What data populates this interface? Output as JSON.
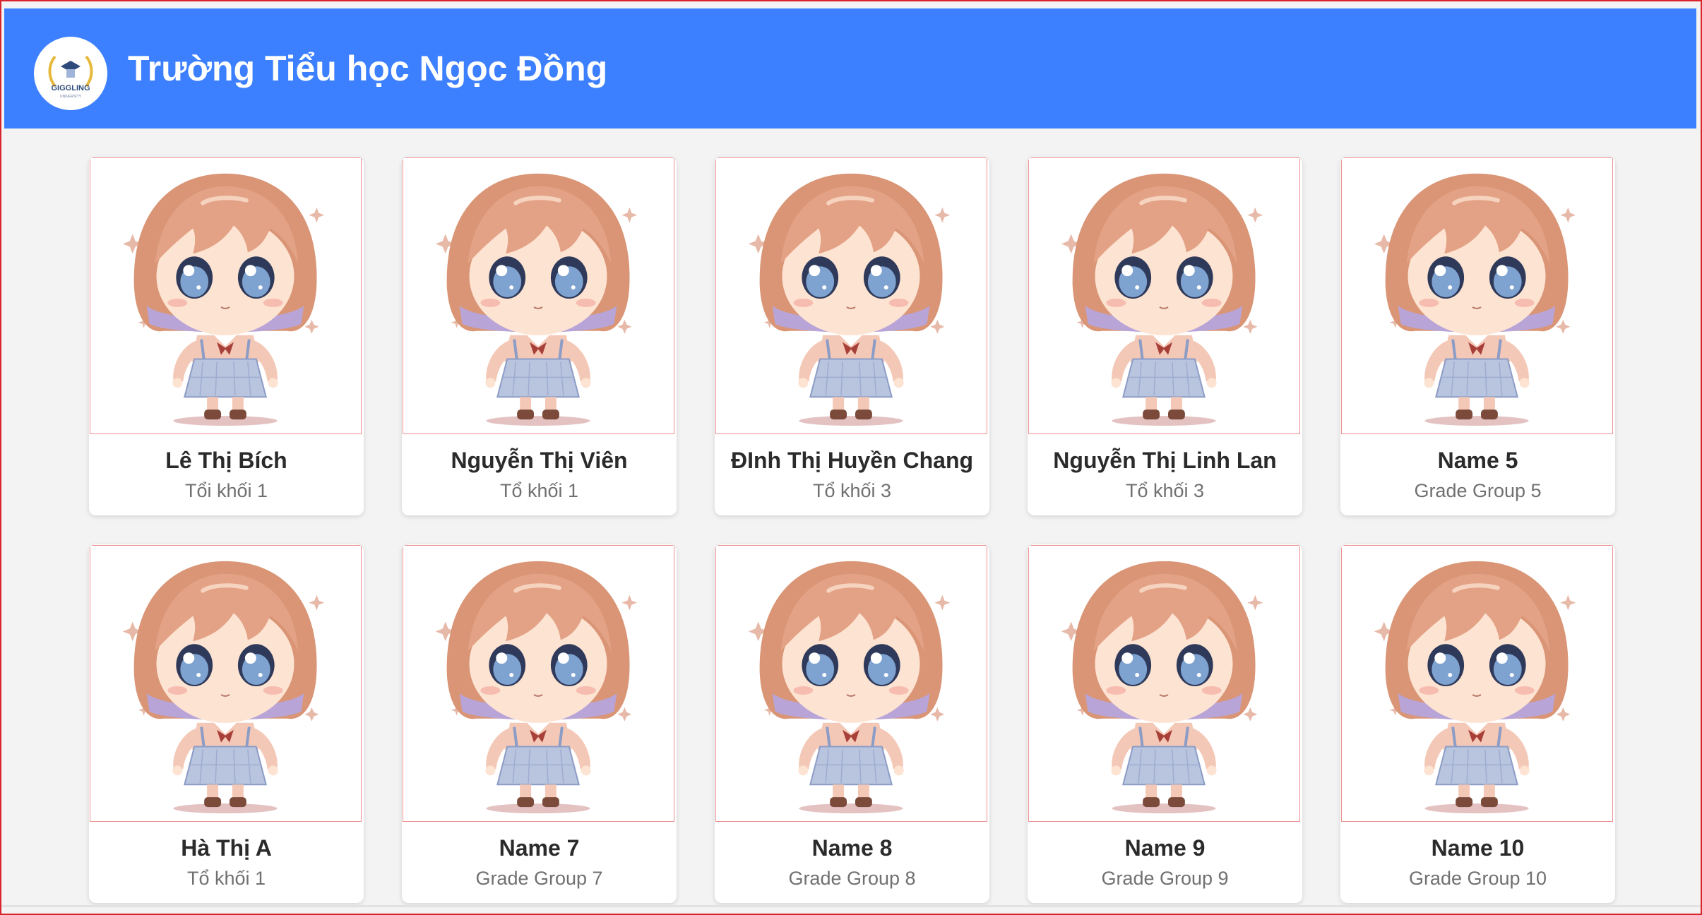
{
  "header": {
    "title": "Trường Tiểu học Ngọc Đồng",
    "logo_text": "GIGGLING",
    "background": "#3d80ff"
  },
  "teachers": [
    {
      "name": "Lê Thị Bích",
      "group": "Tổi khối 1"
    },
    {
      "name": "Nguyễn Thị Viên",
      "group": "Tổ khối 1"
    },
    {
      "name": "ĐInh Thị Huyền Chang",
      "group": "Tổ khối 3"
    },
    {
      "name": "Nguyễn Thị Linh Lan",
      "group": "Tổ khối 3"
    },
    {
      "name": "Name 5",
      "group": "Grade Group 5"
    },
    {
      "name": "Hà Thị A",
      "group": "Tổ khối 1"
    },
    {
      "name": "Name 7",
      "group": "Grade Group 7"
    },
    {
      "name": "Name 8",
      "group": "Grade Group 8"
    },
    {
      "name": "Name 9",
      "group": "Grade Group 9"
    },
    {
      "name": "Name 10",
      "group": "Grade Group 10"
    }
  ],
  "avatar_icon": "chibi-girl-illustration"
}
